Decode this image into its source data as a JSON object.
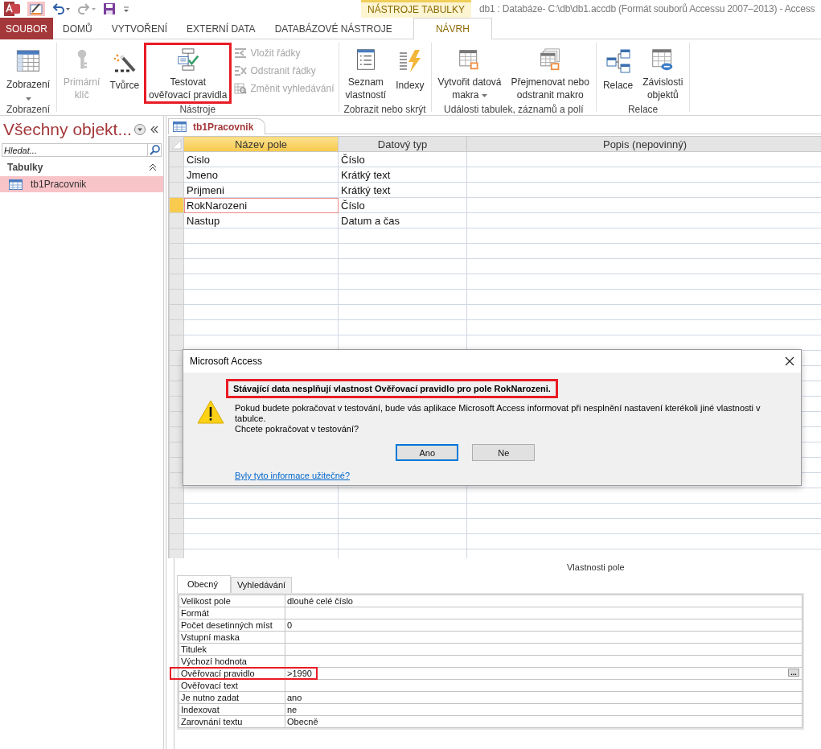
{
  "title_bar": {
    "context_label": "NÁSTROJE TABULKY",
    "title": "db1 : Databáze- C:\\db\\db1.accdb (Formát souborů Accessu 2007–2013) - Access"
  },
  "ribbon_tabs": [
    {
      "label": "SOUBOR",
      "kind": "file",
      "selected": false
    },
    {
      "label": "DOMŮ",
      "kind": "tab",
      "selected": false
    },
    {
      "label": "VYTVOŘENÍ",
      "kind": "tab",
      "selected": false
    },
    {
      "label": "EXTERNÍ DATA",
      "kind": "tab",
      "selected": false
    },
    {
      "label": "DATABÁZOVÉ NÁSTROJE",
      "kind": "tab",
      "selected": false
    },
    {
      "label": "NÁVRH",
      "kind": "context",
      "selected": true
    }
  ],
  "ribbon_groups": [
    {
      "label": "Zobrazení",
      "buttons": [
        {
          "kind": "large",
          "label": "Zobrazení",
          "dropdown": true,
          "disabled": false
        }
      ]
    },
    {
      "label": "Nástroje",
      "buttons": [
        {
          "kind": "large",
          "label": "Primární\nklíč",
          "disabled": true
        },
        {
          "kind": "large",
          "label": "Tvůrce",
          "disabled": false
        },
        {
          "kind": "large",
          "label": "Testovat\nověřovací pravidla",
          "disabled": false,
          "highlighted": true
        },
        {
          "kind": "small",
          "label": "Vložit řádky",
          "disabled": true
        },
        {
          "kind": "small",
          "label": "Odstranit řádky",
          "disabled": true
        },
        {
          "kind": "small",
          "label": "Změnit vyhledávání",
          "disabled": true
        }
      ]
    },
    {
      "label": "Zobrazit nebo skrýt",
      "buttons": [
        {
          "kind": "large",
          "label": "Seznam\nvlastností",
          "disabled": false
        },
        {
          "kind": "large",
          "label": "Indexy",
          "disabled": false
        }
      ]
    },
    {
      "label": "Události tabulek, záznamů a polí",
      "buttons": [
        {
          "kind": "large",
          "label": "Vytvořit datová\nmakra",
          "dropdown": true,
          "disabled": false
        },
        {
          "kind": "large",
          "label": "Přejmenovat nebo\nodstranit makro",
          "disabled": false
        }
      ]
    },
    {
      "label": "Relace",
      "buttons": [
        {
          "kind": "large",
          "label": "Relace",
          "disabled": false
        },
        {
          "kind": "large",
          "label": "Závislosti\nobjektů",
          "disabled": false
        }
      ]
    }
  ],
  "nav_pane": {
    "title": "Všechny objekt...",
    "search": {
      "placeholder": "Hledat..."
    },
    "groups": [
      {
        "label": "Tabulky",
        "expanded": true,
        "items": [
          {
            "label": "tb1Pracovnik",
            "selected": true
          }
        ]
      }
    ]
  },
  "document_tabs": [
    {
      "label": "tb1Pracovnik",
      "selected": true
    }
  ],
  "design_grid": {
    "columns": [
      {
        "label": "Název pole",
        "selected": true
      },
      {
        "label": "Datový typ",
        "selected": false
      },
      {
        "label": "Popis (nepovinný)",
        "selected": false
      }
    ],
    "rows": [
      {
        "field_name": "Cislo",
        "data_type": "Číslo",
        "selected": false
      },
      {
        "field_name": "Jmeno",
        "data_type": "Krátký text",
        "selected": false
      },
      {
        "field_name": "Prijmeni",
        "data_type": "Krátký text",
        "selected": false
      },
      {
        "field_name": "RokNarozeni",
        "data_type": "Číslo",
        "selected": true
      },
      {
        "field_name": "Nastup",
        "data_type": "Datum a čas",
        "selected": false
      }
    ]
  },
  "dialog": {
    "title": "Microsoft Access",
    "heading": "Stávající data nesplňují vlastnost Ověřovací pravidlo pro pole RokNarozeni.",
    "heading_highlighted": true,
    "message": "Pokud budete pokračovat v testování, bude vás aplikace Microsoft Access informovat při nesplnění nastavení kterékoli jiné vlastnosti v\ntabulce.\nChcete pokračovat v testování?",
    "buttons": [
      {
        "label": "Ano",
        "default": true
      },
      {
        "label": "Ne",
        "default": false
      }
    ],
    "link": "Byly tyto informace užitečné?"
  },
  "field_properties": {
    "title": "Vlastnosti pole",
    "tabs": [
      {
        "label": "Obecný",
        "selected": true
      },
      {
        "label": "Vyhledávání",
        "selected": false
      }
    ],
    "rows": [
      {
        "label": "Velikost pole",
        "value": "dlouhé celé číslo"
      },
      {
        "label": "Formát"
      },
      {
        "label": "Počet desetinných míst",
        "value": "0"
      },
      {
        "label": "Vstupní maska"
      },
      {
        "label": "Titulek"
      },
      {
        "label": "Výchozí hodnota"
      },
      {
        "label": "Ověřovací pravidlo",
        "value": ">1990",
        "highlighted": true,
        "builder_button": "..."
      },
      {
        "label": "Ověřovací text"
      },
      {
        "label": "Je nutno zadat",
        "value": "ano"
      },
      {
        "label": "Indexovat",
        "value": "ne"
      },
      {
        "label": "Zarovnání textu",
        "value": "Obecně"
      }
    ]
  }
}
